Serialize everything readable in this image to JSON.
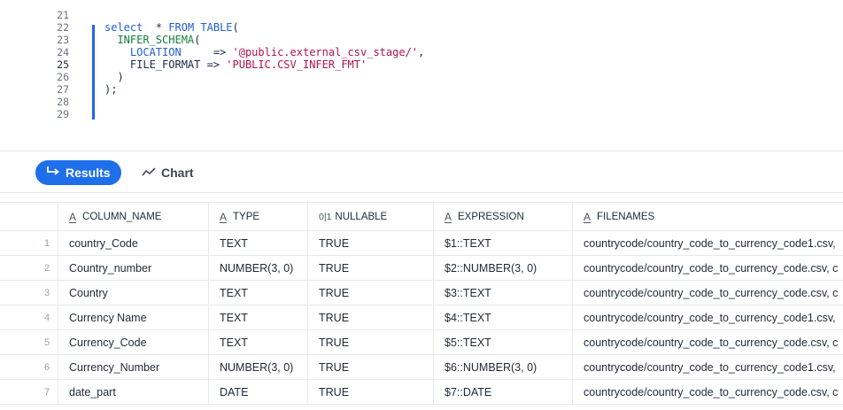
{
  "editor": {
    "lines": [
      {
        "num": "21",
        "tokens": []
      },
      {
        "num": "22",
        "tokens": [
          {
            "t": "select",
            "c": "kw"
          },
          {
            "t": "  * ",
            "c": "plain"
          },
          {
            "t": "FROM",
            "c": "kw"
          },
          {
            "t": " ",
            "c": "plain"
          },
          {
            "t": "TABLE",
            "c": "kw"
          },
          {
            "t": "(",
            "c": "plain"
          }
        ]
      },
      {
        "num": "23",
        "tokens": [
          {
            "t": "  ",
            "c": "plain"
          },
          {
            "t": "INFER_SCHEMA",
            "c": "fn"
          },
          {
            "t": "(",
            "c": "plain"
          }
        ]
      },
      {
        "num": "24",
        "tokens": [
          {
            "t": "    ",
            "c": "plain"
          },
          {
            "t": "LOCATION",
            "c": "kw"
          },
          {
            "t": "     => ",
            "c": "plain"
          },
          {
            "t": "'@public.external_csv_stage/'",
            "c": "str"
          },
          {
            "t": ",",
            "c": "plain"
          }
        ]
      },
      {
        "num": "25",
        "active": true,
        "tokens": [
          {
            "t": "    FILE_FORMAT => ",
            "c": "plain"
          },
          {
            "t": "'PUBLIC.CSV_INFER_FMT'",
            "c": "str"
          }
        ]
      },
      {
        "num": "26",
        "tokens": [
          {
            "t": "  )",
            "c": "plain"
          }
        ]
      },
      {
        "num": "27",
        "tokens": [
          {
            "t": ");",
            "c": "plain"
          }
        ]
      },
      {
        "num": "28",
        "tokens": []
      },
      {
        "num": "29",
        "tokens": []
      }
    ]
  },
  "tabs": {
    "results_label": "Results",
    "chart_label": "Chart",
    "results_icon": "arrow-turn-right-icon",
    "chart_icon": "line-chart-icon",
    "active_color": "#1f6feb"
  },
  "grid": {
    "columns": [
      {
        "label": "COLUMN_NAME",
        "type_icon": "A"
      },
      {
        "label": "TYPE",
        "type_icon": "A"
      },
      {
        "label": "NULLABLE",
        "type_icon": "0|1"
      },
      {
        "label": "EXPRESSION",
        "type_icon": "A"
      },
      {
        "label": "FILENAMES",
        "type_icon": "A"
      }
    ],
    "rows": [
      {
        "num": "1",
        "cells": [
          "country_Code",
          "TEXT",
          "TRUE",
          "$1::TEXT",
          "countrycode/country_code_to_currency_code1.csv,"
        ]
      },
      {
        "num": "2",
        "cells": [
          "Country_number",
          "NUMBER(3, 0)",
          "TRUE",
          "$2::NUMBER(3, 0)",
          "countrycode/country_code_to_currency_code.csv, c"
        ]
      },
      {
        "num": "3",
        "cells": [
          "Country",
          "TEXT",
          "TRUE",
          "$3::TEXT",
          "countrycode/country_code_to_currency_code.csv, c"
        ]
      },
      {
        "num": "4",
        "cells": [
          "Currency Name",
          "TEXT",
          "TRUE",
          "$4::TEXT",
          "countrycode/country_code_to_currency_code1.csv,"
        ]
      },
      {
        "num": "5",
        "cells": [
          "Currency_Code",
          "TEXT",
          "TRUE",
          "$5::TEXT",
          "countrycode/country_code_to_currency_code.csv, c"
        ]
      },
      {
        "num": "6",
        "cells": [
          "Currency_Number",
          "NUMBER(3, 0)",
          "TRUE",
          "$6::NUMBER(3, 0)",
          "countrycode/country_code_to_currency_code1.csv,"
        ]
      },
      {
        "num": "7",
        "cells": [
          "date_part",
          "DATE",
          "TRUE",
          "$7::DATE",
          "countrycode/country_code_to_currency_code.csv, c"
        ]
      }
    ]
  }
}
